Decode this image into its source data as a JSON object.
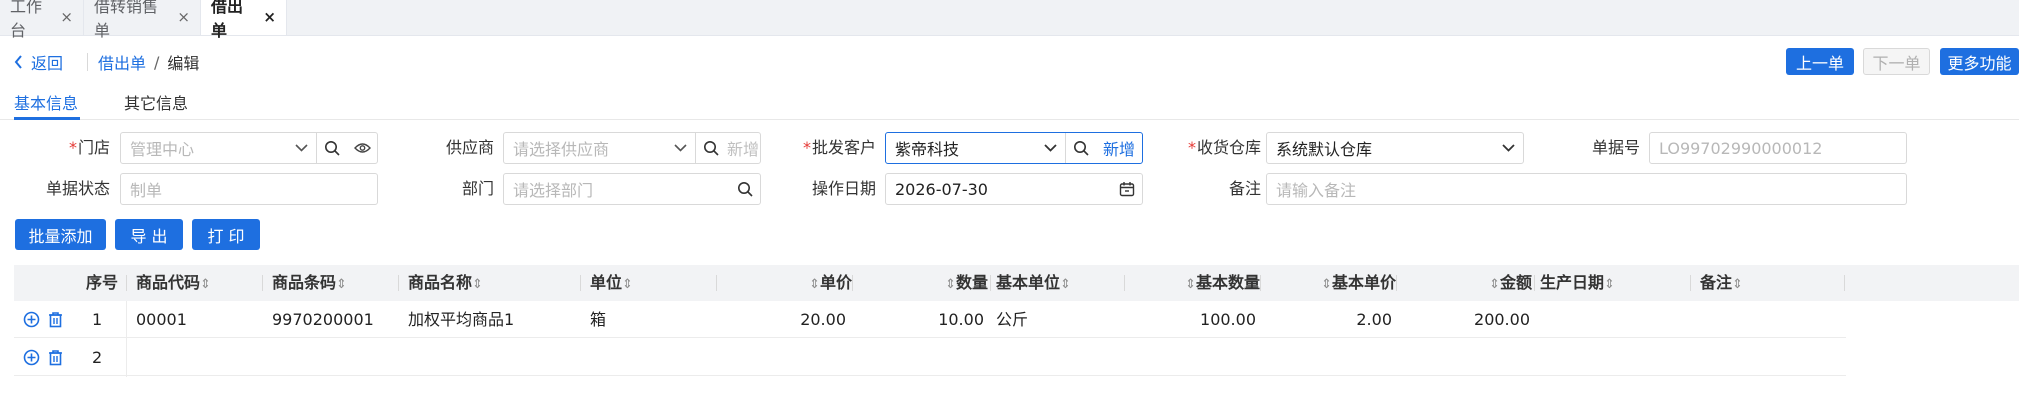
{
  "tabs": [
    {
      "label": "工作台",
      "close": "×"
    },
    {
      "label": "借转销售单",
      "close": "×"
    },
    {
      "label": "借出单",
      "close": "×"
    }
  ],
  "header": {
    "back_label": "返回",
    "breadcrumb": {
      "link": "借出单",
      "separator": "/",
      "current": "编辑"
    },
    "prev_label": "上一单",
    "next_label": "下一单",
    "more_label": "更多功能"
  },
  "info_tabs": {
    "basic": "基本信息",
    "other": "其它信息"
  },
  "form": {
    "store": {
      "label": "门店",
      "placeholder": "管理中心"
    },
    "supplier": {
      "label": "供应商",
      "placeholder": "请选择供应商",
      "add": "新增"
    },
    "customer": {
      "label": "批发客户",
      "value": "紫帝科技",
      "add": "新增"
    },
    "warehouse": {
      "label": "收货仓库",
      "value": "系统默认仓库"
    },
    "doc_no": {
      "label": "单据号",
      "placeholder": "LO99702990000012"
    },
    "status": {
      "label": "单据状态",
      "placeholder": "制单"
    },
    "department": {
      "label": "部门",
      "placeholder": "请选择部门"
    },
    "date": {
      "label": "操作日期",
      "value": "2026-07-30"
    },
    "remark": {
      "label": "备注",
      "placeholder": "请输入备注"
    }
  },
  "actions": {
    "batch_add": "批量添加",
    "export": "导 出",
    "print": "打 印"
  },
  "sort_icon": "⇕",
  "table": {
    "columns": {
      "seq": "序号",
      "code": "商品代码",
      "barcode": "商品条码",
      "name": "商品名称",
      "unit": "单位",
      "price": "单价",
      "qty": "数量",
      "base_unit": "基本单位",
      "base_qty": "基本数量",
      "base_price": "基本单价",
      "amount": "金额",
      "prod_date": "生产日期",
      "remark": "备注"
    },
    "rows": [
      {
        "seq": "1",
        "code": "00001",
        "barcode": "9970200001",
        "name": "加权平均商品1",
        "unit": "箱",
        "price": "20.00",
        "qty": "10.00",
        "base_unit": "公斤",
        "base_qty": "100.00",
        "base_price": "2.00",
        "amount": "200.00"
      },
      {
        "seq": "2"
      }
    ]
  },
  "colors": {
    "primary": "#1e6fe0",
    "required": "#e53935"
  }
}
